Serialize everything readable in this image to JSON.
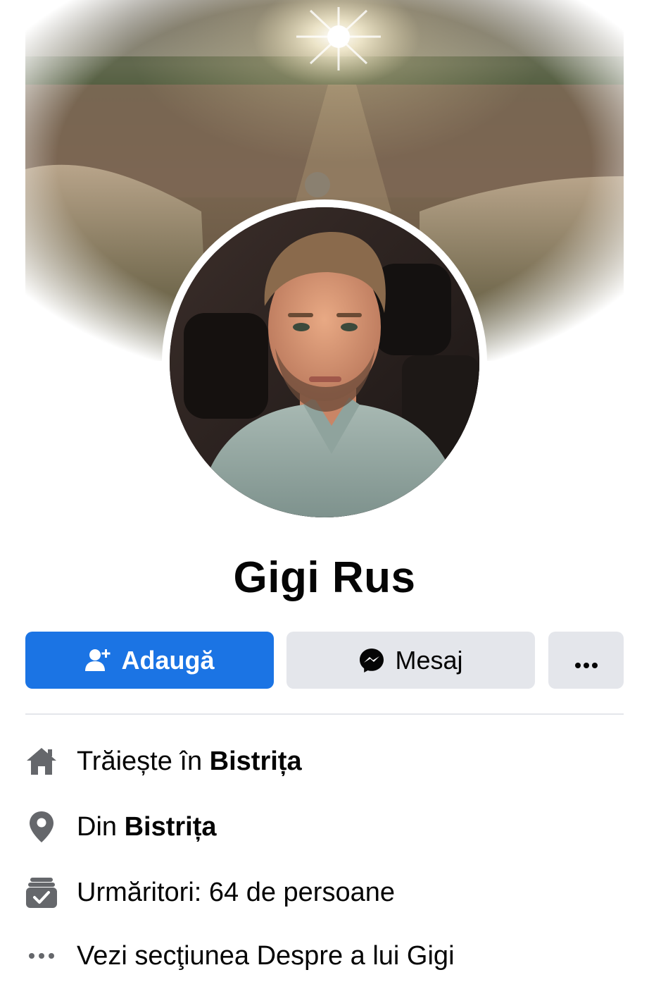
{
  "profile": {
    "name": "Gigi Rus"
  },
  "actions": {
    "add_label": "Adaugă",
    "message_label": "Mesaj",
    "more_icon": "more-horizontal-icon"
  },
  "intro": {
    "lives_in_prefix": "Trăiește în ",
    "lives_in_city": "Bistrița",
    "from_prefix": "Din ",
    "from_city": "Bistrița",
    "followers_text": "Urmăritori: 64 de persoane",
    "see_about_text": "Vezi secţiunea Despre a lui Gigi"
  },
  "icons": {
    "lives_in": "home-icon",
    "from": "location-pin-icon",
    "followers": "followers-icon",
    "see_about": "more-horizontal-icon"
  },
  "colors": {
    "primary_button": "#1b74e4",
    "secondary_button": "#e4e6eb",
    "icon_gray": "#65676b",
    "text": "#050505"
  }
}
